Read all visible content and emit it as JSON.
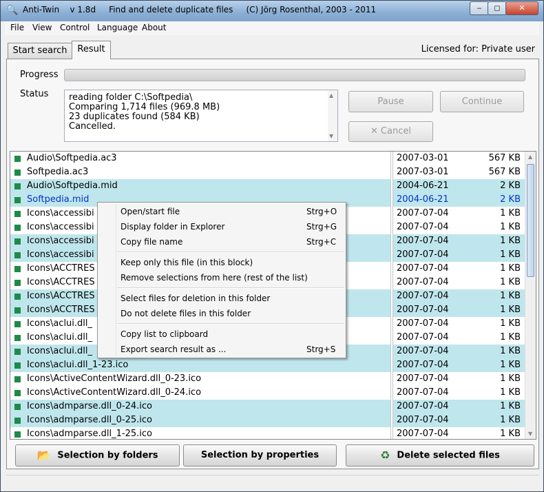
{
  "window": {
    "title": "Anti-Twin    v 1.8d     Find and delete duplicate files     (C) Jörg Rosenthal, 2003 - 2011",
    "icon": "magnifier-icon",
    "min_label": "‒",
    "max_label": "◻",
    "close_label": "✕"
  },
  "menu": [
    "File",
    "View",
    "Control",
    "Language",
    "About"
  ],
  "tabs": [
    {
      "label": "Start search",
      "active": false
    },
    {
      "label": "Result",
      "active": true
    }
  ],
  "licensed": "Licensed for: Private user",
  "progress": {
    "label": "Progress",
    "value": 0
  },
  "status": {
    "label": "Status",
    "lines": [
      "reading folder C:\\Softpedia\\",
      "Comparing 1,714 files (969.8 MB)",
      "23 duplicates found (584 KB)",
      "Cancelled."
    ]
  },
  "buttons": {
    "pause": "Pause",
    "continue": "Continue",
    "cancel": "Cancel"
  },
  "rows": [
    {
      "name": "Audio\\Softpedia.ac3",
      "date": "2007-03-01",
      "size": "567 KB",
      "band": false,
      "blue": false
    },
    {
      "name": "Softpedia.ac3",
      "date": "2007-03-01",
      "size": "567 KB",
      "band": false,
      "blue": false
    },
    {
      "name": "Audio\\Softpedia.mid",
      "date": "2004-06-21",
      "size": "2 KB",
      "band": true,
      "blue": false
    },
    {
      "name": "Softpedia.mid",
      "date": "2004-06-21",
      "size": "2 KB",
      "band": true,
      "blue": true
    },
    {
      "name": "Icons\\accessibi",
      "date": "2007-07-04",
      "size": "1 KB",
      "band": false,
      "blue": false
    },
    {
      "name": "Icons\\accessibi",
      "date": "2007-07-04",
      "size": "1 KB",
      "band": false,
      "blue": false
    },
    {
      "name": "Icons\\accessibi",
      "date": "2007-07-04",
      "size": "1 KB",
      "band": true,
      "blue": false
    },
    {
      "name": "Icons\\accessibi",
      "date": "2007-07-04",
      "size": "1 KB",
      "band": true,
      "blue": false
    },
    {
      "name": "Icons\\ACCTRES",
      "date": "2007-07-04",
      "size": "1 KB",
      "band": false,
      "blue": false
    },
    {
      "name": "Icons\\ACCTRES",
      "date": "2007-07-04",
      "size": "1 KB",
      "band": false,
      "blue": false
    },
    {
      "name": "Icons\\ACCTRES",
      "date": "2007-07-04",
      "size": "1 KB",
      "band": true,
      "blue": false
    },
    {
      "name": "Icons\\ACCTRES",
      "date": "2007-07-04",
      "size": "1 KB",
      "band": true,
      "blue": false
    },
    {
      "name": "Icons\\aclui.dll_",
      "date": "2007-07-04",
      "size": "1 KB",
      "band": false,
      "blue": false
    },
    {
      "name": "Icons\\aclui.dll_",
      "date": "2007-07-04",
      "size": "1 KB",
      "band": false,
      "blue": false
    },
    {
      "name": "Icons\\aclui.dll_",
      "date": "2007-07-04",
      "size": "1 KB",
      "band": true,
      "blue": false
    },
    {
      "name": "Icons\\aclui.dll_1-23.ico",
      "date": "2007-07-04",
      "size": "1 KB",
      "band": true,
      "blue": false
    },
    {
      "name": "Icons\\ActiveContentWizard.dll_0-23.ico",
      "date": "2007-07-04",
      "size": "1 KB",
      "band": false,
      "blue": false
    },
    {
      "name": "Icons\\ActiveContentWizard.dll_0-24.ico",
      "date": "2007-07-04",
      "size": "1 KB",
      "band": false,
      "blue": false
    },
    {
      "name": "Icons\\admparse.dll_0-24.ico",
      "date": "2007-07-04",
      "size": "1 KB",
      "band": true,
      "blue": false
    },
    {
      "name": "Icons\\admparse.dll_0-25.ico",
      "date": "2007-07-04",
      "size": "1 KB",
      "band": true,
      "blue": false
    },
    {
      "name": "Icons\\admparse.dll_1-25.ico",
      "date": "2007-07-04",
      "size": "1 KB",
      "band": false,
      "blue": false
    }
  ],
  "context_menu": {
    "groups": [
      [
        {
          "label": "Open/start file",
          "shortcut": "Strg+O"
        },
        {
          "label": "Display folder in Explorer",
          "shortcut": "Strg+G"
        },
        {
          "label": "Copy file name",
          "shortcut": "Strg+C"
        }
      ],
      [
        {
          "label": "Keep only this file (in this block)",
          "shortcut": ""
        },
        {
          "label": "Remove selections from here (rest of the list)",
          "shortcut": ""
        }
      ],
      [
        {
          "label": "Select files for deletion in this folder",
          "shortcut": ""
        },
        {
          "label": "Do not delete files in this folder",
          "shortcut": ""
        }
      ],
      [
        {
          "label": "Copy list to clipboard",
          "shortcut": ""
        },
        {
          "label": "Export search result as ...",
          "shortcut": "Strg+S"
        }
      ]
    ]
  },
  "bottom_buttons": {
    "folders": "Selection by folders",
    "properties": "Selection by properties",
    "delete": "Delete selected files"
  },
  "colors": {
    "band": "#bfe6ec",
    "marker": "#1e8a48",
    "selected_text": "#0033cc"
  }
}
